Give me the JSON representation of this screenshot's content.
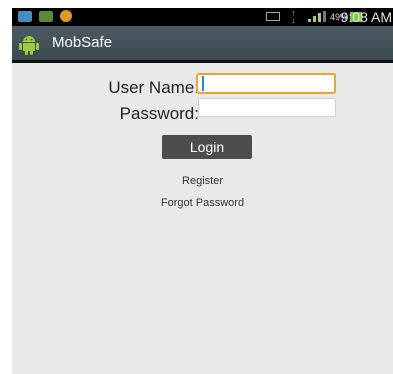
{
  "status_bar": {
    "battery_percent": "49%",
    "time": "9:08 AM",
    "icons": [
      "wifi-icon",
      "mail-icon",
      "app-notification-icon",
      "vibrate-icon",
      "data-activity-icon",
      "signal-icon",
      "battery-icon"
    ]
  },
  "action_bar": {
    "title": "MobSafe",
    "icon": "android-icon"
  },
  "form": {
    "username_label": "User Name:",
    "username_value": "",
    "password_label": "Password:",
    "password_value": "",
    "login_label": "Login"
  },
  "links": {
    "register": "Register",
    "forgot_password": "Forgot Password"
  },
  "colors": {
    "action_bar": "#44525a",
    "focus_border": "#e4a72f",
    "button": "#4d4d4d",
    "background": "#e9e9e9"
  }
}
